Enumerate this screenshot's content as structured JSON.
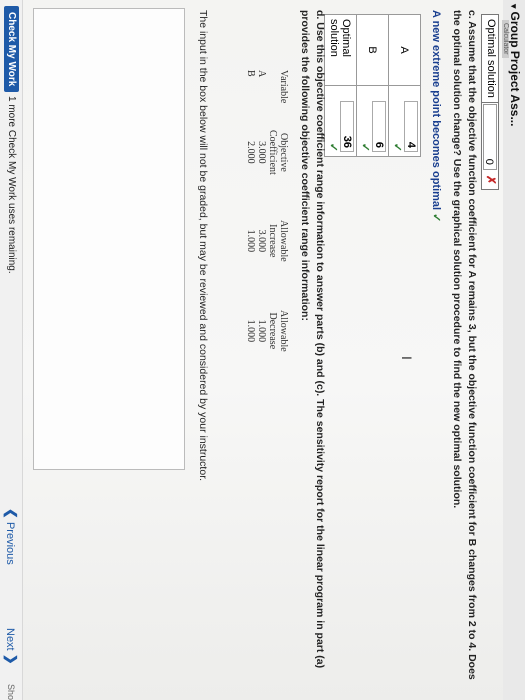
{
  "header": {
    "chevron": "▾",
    "title": "Group Project Ass...",
    "subtitle": "Calculator"
  },
  "prev_answer": {
    "label": "Optimal solution",
    "value": "0",
    "mark": "✗"
  },
  "part_c": {
    "question": "c. Assume that the objective function coefficient for A remains 3, but the objective function coefficient for B changes from 2 to 4. Does the optimal solution change? Use the graphical solution procedure to find the new optimal solution.",
    "new_point_text": "A new extreme point becomes optimal",
    "check": "✓",
    "rows": [
      {
        "label": "A",
        "value": "4",
        "check": "✓"
      },
      {
        "label": "B",
        "value": "6",
        "check": "✓"
      },
      {
        "label": "Optimal solution",
        "value": "36",
        "check": "✓"
      }
    ]
  },
  "cursor": "I",
  "part_d": {
    "question": "d. Use this objective coefficient range information to answer parts (b) and (c). The sensitivity report for the linear program in part (a) provides the following objective coefficient range information:",
    "table": {
      "col1": [
        "Variable",
        "",
        "A",
        "B"
      ],
      "col2": [
        "Objective",
        "Coefficient",
        "3.000",
        "2.000"
      ],
      "col3": [
        "Allowable",
        "Increase",
        "3.000",
        "1.000"
      ],
      "col4": [
        "Allowable",
        "Decrease",
        "1.000",
        "1.000"
      ]
    },
    "note": "The input in the box below will not be graded, but may be reviewed and considered by your instructor."
  },
  "footer": {
    "check_my_work": "Check My Work",
    "remaining": "1 more Check My Work uses remaining.",
    "previous": "Previous",
    "next": "Next",
    "sho": "Sho"
  },
  "colors": {
    "accent": "#1e5aa8",
    "correct": "#2e7d32",
    "wrong": "#c62828"
  }
}
